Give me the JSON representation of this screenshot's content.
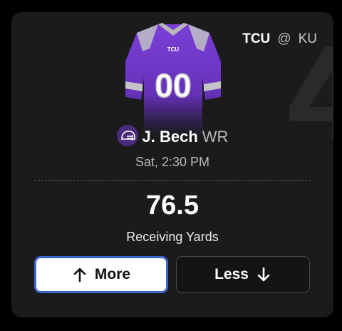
{
  "matchup": {
    "home_team": "TCU",
    "separator": "@",
    "away_team": "KU"
  },
  "jersey": {
    "team_text": "TCU",
    "number": "00",
    "color": "#6a34c4"
  },
  "player": {
    "name": "J. Bech",
    "position": "WR",
    "game_time": "Sat, 2:30 PM"
  },
  "projection": {
    "line": "76.5",
    "stat": "Receiving Yards"
  },
  "actions": {
    "more_label": "More",
    "less_label": "Less"
  },
  "colors": {
    "card_bg": "#1b1b1c",
    "selected_border": "#3c67c9",
    "team_purple": "#4a2a7a"
  }
}
